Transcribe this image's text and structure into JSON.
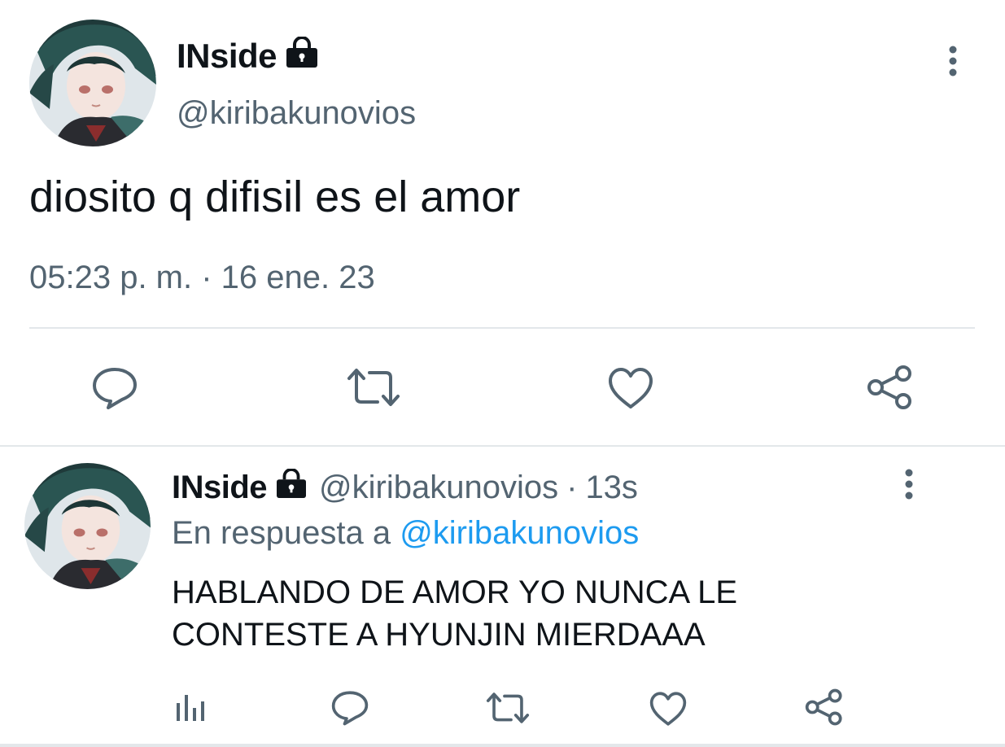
{
  "main_tweet": {
    "display_name": "INside",
    "handle": "@kiribakunovios",
    "text": "diosito q difisil es el amor",
    "timestamp": "05:23 p. m. · 16 ene. 23",
    "avatar_icon": "anime-avatar-image",
    "lock_icon": "lock-icon",
    "more_icon": "more-vertical-icon",
    "actions": [
      {
        "name": "reply",
        "icon": "reply-icon"
      },
      {
        "name": "retweet",
        "icon": "retweet-icon"
      },
      {
        "name": "like",
        "icon": "heart-icon"
      },
      {
        "name": "share",
        "icon": "share-icon"
      }
    ]
  },
  "reply_tweet": {
    "display_name": "INside",
    "handle": "@kiribakunovios",
    "separator": "·",
    "time_ago": "13s",
    "reply_prefix": "En respuesta a",
    "reply_to": "@kiribakunovios",
    "text": "HABLANDO DE AMOR YO NUNCA LE CONTESTE A HYUNJIN MIERDAAA",
    "actions": [
      {
        "name": "analytics",
        "icon": "analytics-icon"
      },
      {
        "name": "reply",
        "icon": "reply-icon"
      },
      {
        "name": "retweet",
        "icon": "retweet-icon"
      },
      {
        "name": "like",
        "icon": "heart-icon"
      },
      {
        "name": "share",
        "icon": "share-icon"
      }
    ]
  },
  "colors": {
    "text_primary": "#0f1419",
    "text_secondary": "#536471",
    "icon": "#536471",
    "mention": "#1d9bf0",
    "divider": "#e3e7ea"
  }
}
